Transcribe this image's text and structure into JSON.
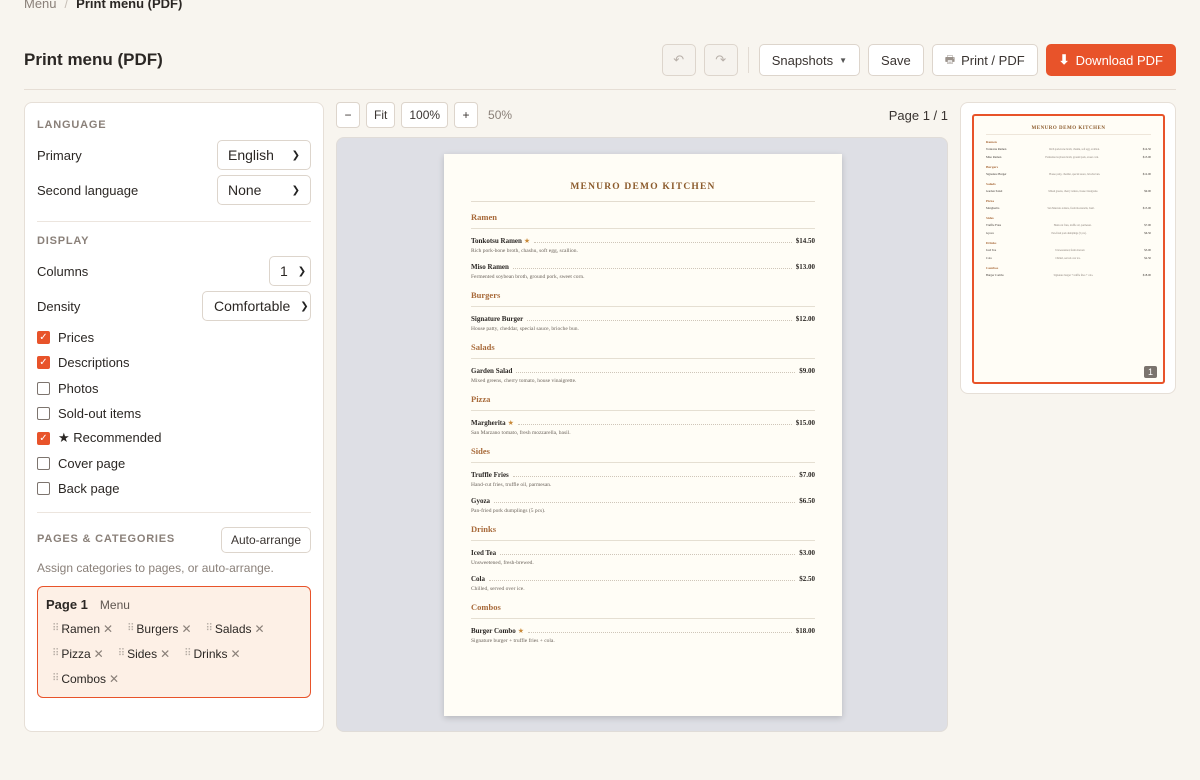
{
  "breadcrumb": {
    "parent": "Menu",
    "separator": "/",
    "current": "Print menu (PDF)"
  },
  "header": {
    "title": "Print menu (PDF)"
  },
  "toolbar": {
    "undo_icon": "undo-icon",
    "redo_icon": "redo-icon",
    "snapshots_label": "Snapshots",
    "save_label": "Save",
    "print_label": "Print / PDF",
    "download_label": "Download PDF"
  },
  "settings": {
    "language": {
      "title": "LANGUAGE",
      "primary_label": "Primary",
      "primary_value": "English",
      "second_label": "Second language",
      "second_value": "None"
    },
    "display": {
      "title": "DISPLAY",
      "columns_label": "Columns",
      "columns_value": "1",
      "density_label": "Density",
      "density_value": "Comfortable",
      "options": [
        {
          "label": "Prices",
          "checked": true
        },
        {
          "label": "Descriptions",
          "checked": true
        },
        {
          "label": "Photos",
          "checked": false
        },
        {
          "label": "Sold-out items",
          "checked": false
        },
        {
          "label": "★ Recommended",
          "checked": true
        },
        {
          "label": "Cover page",
          "checked": false
        },
        {
          "label": "Back page",
          "checked": false
        }
      ]
    },
    "pages": {
      "title": "PAGES & CATEGORIES",
      "auto_label": "Auto-arrange",
      "hint": "Assign categories to pages, or auto-arrange.",
      "page_name": "Page 1",
      "page_sub": "Menu",
      "chips": [
        "Ramen",
        "Burgers",
        "Salads",
        "Pizza",
        "Sides",
        "Drinks",
        "Combos"
      ]
    }
  },
  "preview": {
    "zoom_out": "−",
    "fit": "Fit",
    "zoom_100": "100%",
    "zoom_in": "+",
    "zoom_current": "50%",
    "page_indicator": "Page 1 / 1"
  },
  "menu": {
    "title": "MENURO DEMO KITCHEN",
    "categories": [
      {
        "name": "Ramen",
        "items": [
          {
            "name": "Tonkotsu Ramen",
            "star": true,
            "price": "$14.50",
            "desc": "Rich pork-bone broth, chashu, soft egg, scallion."
          },
          {
            "name": "Miso Ramen",
            "star": false,
            "price": "$13.00",
            "desc": "Fermented soybean broth, ground pork, sweet corn."
          }
        ]
      },
      {
        "name": "Burgers",
        "items": [
          {
            "name": "Signature Burger",
            "star": false,
            "price": "$12.00",
            "desc": "House patty, cheddar, special sauce, brioche bun."
          }
        ]
      },
      {
        "name": "Salads",
        "items": [
          {
            "name": "Garden Salad",
            "star": false,
            "price": "$9.00",
            "desc": "Mixed greens, cherry tomato, house vinaigrette."
          }
        ]
      },
      {
        "name": "Pizza",
        "items": [
          {
            "name": "Margherita",
            "star": true,
            "price": "$15.00",
            "desc": "San Marzano tomato, fresh mozzarella, basil."
          }
        ]
      },
      {
        "name": "Sides",
        "items": [
          {
            "name": "Truffle Fries",
            "star": false,
            "price": "$7.00",
            "desc": "Hand-cut fries, truffle oil, parmesan."
          },
          {
            "name": "Gyoza",
            "star": false,
            "price": "$6.50",
            "desc": "Pan-fried pork dumplings (5 pcs)."
          }
        ]
      },
      {
        "name": "Drinks",
        "items": [
          {
            "name": "Iced Tea",
            "star": false,
            "price": "$3.00",
            "desc": "Unsweetened, fresh-brewed."
          },
          {
            "name": "Cola",
            "star": false,
            "price": "$2.50",
            "desc": "Chilled, served over ice."
          }
        ]
      },
      {
        "name": "Combos",
        "items": [
          {
            "name": "Burger Combo",
            "star": true,
            "price": "$18.00",
            "desc": "Signature burger + truffle fries + cola."
          }
        ]
      }
    ]
  },
  "thumbnail": {
    "page_number": "1"
  },
  "colors": {
    "accent": "#e8532a",
    "category": "#a86a3a",
    "title": "#8b5a2b"
  }
}
